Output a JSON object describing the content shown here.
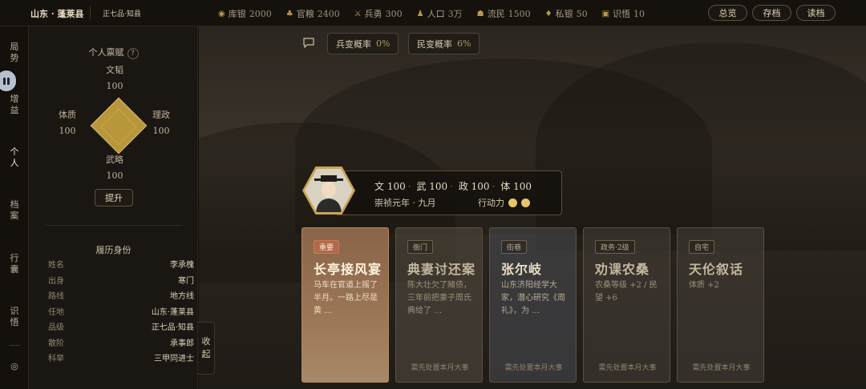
{
  "topbar": {
    "location": "山东 · 蓬莱县",
    "rank": "正七品·知县",
    "stats": [
      {
        "icon": "coin-icon",
        "label": "库银",
        "value": "2000"
      },
      {
        "icon": "bag-icon",
        "label": "官粮",
        "value": "2400"
      },
      {
        "icon": "sword-icon",
        "label": "兵勇",
        "value": "300"
      },
      {
        "icon": "person-icon",
        "label": "人口",
        "value": "3万"
      },
      {
        "icon": "people-icon",
        "label": "流民",
        "value": "1500"
      },
      {
        "icon": "purse-icon",
        "label": "私银",
        "value": "50"
      },
      {
        "icon": "book-icon",
        "label": "识悟",
        "value": "10"
      }
    ],
    "buttons": {
      "overview": "总览",
      "save": "存档",
      "load": "读档"
    }
  },
  "nav": {
    "items": [
      {
        "label1": "局",
        "label2": "势"
      },
      {
        "label1": "增",
        "label2": "益"
      },
      {
        "label1": "个",
        "label2": "人"
      },
      {
        "label1": "档",
        "label2": "案"
      },
      {
        "label1": "行",
        "label2": "囊"
      },
      {
        "label1": "识",
        "label2": "悟"
      }
    ],
    "settings_glyph": "◎"
  },
  "panel": {
    "title": "个人禀赋",
    "help": "?",
    "attrs": {
      "top": {
        "name": "文韬",
        "value": "100"
      },
      "left": {
        "name": "体质",
        "value": "100"
      },
      "right": {
        "name": "理政",
        "value": "100"
      },
      "bottom": {
        "name": "武略",
        "value": "100"
      }
    },
    "raise_label": "提升",
    "bio_title": "履历身份",
    "bio": [
      {
        "k": "姓名",
        "v": "李承槐"
      },
      {
        "k": "出身",
        "v": "寒门"
      },
      {
        "k": "路线",
        "v": "地方线"
      },
      {
        "k": "任地",
        "v": "山东·蓬莱县"
      },
      {
        "k": "品级",
        "v": "正七品·知县"
      },
      {
        "k": "散阶",
        "v": "承事郎"
      },
      {
        "k": "科举",
        "v": "三甲同进士"
      }
    ]
  },
  "collapse": {
    "c1": "收",
    "c2": "起"
  },
  "main": {
    "chat_icon": "chat-icon",
    "mutiny": {
      "label": "兵变概率",
      "value": "0%"
    },
    "revolt": {
      "label": "民变概率",
      "value": "6%"
    },
    "character": {
      "stats": [
        {
          "k": "文",
          "v": "100"
        },
        {
          "k": "武",
          "v": "100"
        },
        {
          "k": "政",
          "v": "100"
        },
        {
          "k": "体",
          "v": "100"
        }
      ],
      "date": "崇祯元年 · 九月",
      "action_label": "行动力",
      "action_points": 2
    },
    "cards": [
      {
        "tag": "重要",
        "title": "长亭接风宴",
        "desc": "马车在官道上摇了半月。一路上尽是黄 …",
        "foot": ""
      },
      {
        "tag": "衙门",
        "title": "典妻讨还案",
        "desc": "陈大壮欠了赌债，三年前把妻子周氏典给了 …",
        "foot": "需先处置本月大事"
      },
      {
        "tag": "街巷",
        "title": "张尔岐",
        "desc": "山东济阳经学大家，潜心研究《周礼》，为 …",
        "foot": "需先处置本月大事"
      },
      {
        "tag": "政务·2级",
        "title": "劝课农桑",
        "desc": "农桑等级 +2 / 民望 +6",
        "foot": "需先处置本月大事"
      },
      {
        "tag": "自宅",
        "title": "天伦叙话",
        "desc": "体质 +2",
        "foot": "需先处置本月大事"
      }
    ]
  }
}
